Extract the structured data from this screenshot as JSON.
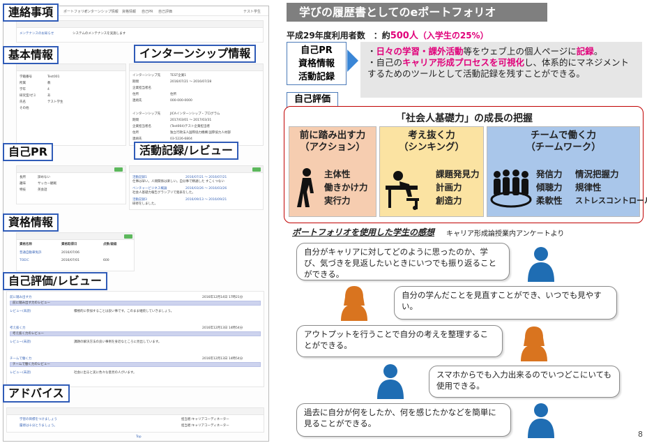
{
  "left": {
    "labels": {
      "notice": "連絡事項",
      "basic": "基本情報",
      "intern": "インターンシップ情報",
      "selfpr": "自己PR",
      "activity": "活動記録/レビュー",
      "qualify": "資格情報",
      "selfeval": "自己評価/レビュー",
      "advice": "アドバイス"
    },
    "nav": [
      "ポートフォリオ",
      "インターンシップ情報",
      "資格情報",
      "自己PR",
      "自己評価"
    ],
    "nav_user": "テスト学生",
    "notice_row": [
      "メンテナンスのお知らせ",
      "システムのメンテナンスを実施します"
    ],
    "basic_rows": [
      [
        "学籍番号",
        "Test001"
      ],
      [
        "所属",
        "教"
      ],
      [
        "学年",
        "4"
      ],
      [
        "研究室/ゼミ",
        "あ"
      ],
      [
        "氏名",
        "テスト学生"
      ],
      [
        "その他",
        ""
      ]
    ],
    "intern_rows": [
      [
        "インターンシップ先",
        "TEST企業1"
      ],
      [
        "期間",
        "2016/07/21 〜 2016/07/28"
      ],
      [
        "企業担当者名",
        ""
      ],
      [
        "住所",
        "住所"
      ],
      [
        "連絡先",
        "000-000-0000"
      ],
      [
        "インターンシップ先",
        "JICAインターンシップ・プログラム"
      ],
      [
        "期間",
        "2017/03/01 〜 2017/03/31"
      ],
      [
        "企業担当者名",
        "(Test004)テスト企業担当者"
      ],
      [
        "住所",
        "独立行政法人国際協力機構 国際協力人材部"
      ],
      [
        "連絡先",
        "03-5226-6804"
      ]
    ],
    "selfpr_rows": [
      [
        "長所",
        "諦めない"
      ],
      [
        "趣味",
        "サッカー観戦"
      ],
      [
        "特技",
        "英会話"
      ]
    ],
    "activity_rows": [
      [
        "活動記録1",
        "2016/07/21 〜 2016/07/21",
        "仕事は早い。人間関係は楽しい。自分事で精通した すこくつない"
      ],
      [
        "ベンチャービジネス概論",
        "2016/03/26 〜 2016/03/26",
        "社会人基礎力報告グランプリで発表をした。"
      ],
      [
        "活動記録3",
        "2016/09/13 〜 2016/09/21",
        "研修をしました。"
      ]
    ],
    "qualify_head": [
      "資格名称",
      "資格取得日",
      "点数/級級"
    ],
    "qualify_rows": [
      [
        "普通自動車免許",
        "2016/07/06",
        ""
      ],
      [
        "TOEIC",
        "2016/07/01",
        "600"
      ]
    ],
    "eval_groups": [
      [
        "前に踏み出す力",
        "前に踏み出す力のレビュー",
        "2016年12月14日 17時21分"
      ],
      [
        "考え抜く力",
        "考え抜く力のレビュー",
        "2016年12月13日 14時54分"
      ],
      [
        "チームで働く力",
        "チームで働く力のレビュー",
        "2016年12月13日 14時54分"
      ]
    ],
    "eval_texts": [
      "積極的に参加することは良い事です。このまま継続していきましょう。",
      "課題の解決方法の良い事例を身近なところに見出しています。",
      "社会に出ると実に色々な意見の人がいます。"
    ],
    "review_link": "レビュー(未読)",
    "advice_rows": [
      [
        "学習の目標をつけましょう",
        "担当者:キャリアコーディネーター"
      ],
      [
        "履修は十分とりましょう。",
        "担当者:キャリアコーディネーター"
      ]
    ],
    "top": "Top"
  },
  "right": {
    "title": "学びの履歴書としてのeポートフォリオ",
    "usage": {
      "prefix": "平成29年度利用者数　：約",
      "count": "500人",
      "paren": "（入学生の25%）"
    },
    "box1": [
      "自己PR",
      "資格情報",
      "活動記録"
    ],
    "desc": {
      "l1a": "・",
      "l1b": "日々の学習・課外活動",
      "l1c": "等をウェブ上の個人ページに",
      "l1d": "記録",
      "l1e": "。",
      "l2a": "・自己の",
      "l2b": "キャリア形成プロセスを可視化",
      "l2c": "し、体系的にマネジメントするためのツールとして活動記録を残すことができる。"
    },
    "box2": "自己評価",
    "framework_title": "「社会人基礎力」の成長の把握",
    "caps": [
      {
        "h1": "前に踏み出す力",
        "h2": "（アクション）",
        "skills": [
          "主体性",
          "働きかけ力",
          "実行力"
        ],
        "color": "#f6cdb0"
      },
      {
        "h1": "考え抜く力",
        "h2": "（シンキング）",
        "skills": [
          "課題発見力",
          "計画力",
          "創造力"
        ],
        "color": "#fbe3a2"
      },
      {
        "h1": "チームで働く力",
        "h2": "（チームワーク）",
        "skills": [
          "発信力",
          "傾聴力",
          "柔軟性"
        ],
        "skills2": [
          "情況把握力",
          "規律性",
          "ストレスコントロール力"
        ],
        "color": "#a9c6ea"
      }
    ],
    "port_title": "ポートフォリオを使用した学生の感想",
    "port_sub": "キャリア形成論授業内アンケートより",
    "bubbles": [
      "自分がキャリアに対してどのように思ったのか、学び、気づきを見返したいときにいつでも振り返ることができる。",
      "自分の学んだことを見直すことができ、いつでも見やすい。",
      "アウトプットを行うことで自分の考えを整理することができる。",
      "スマホからでも入力出来るのでいつどこにいても使用できる。",
      "過去に自分が何をしたか、何を感じたかなどを簡単に見ることができる。"
    ],
    "colors": {
      "accent": "#e0007a",
      "blue": "#3a86d6",
      "male": "#1f6db3",
      "female": "#d9741f"
    },
    "page": "8"
  }
}
